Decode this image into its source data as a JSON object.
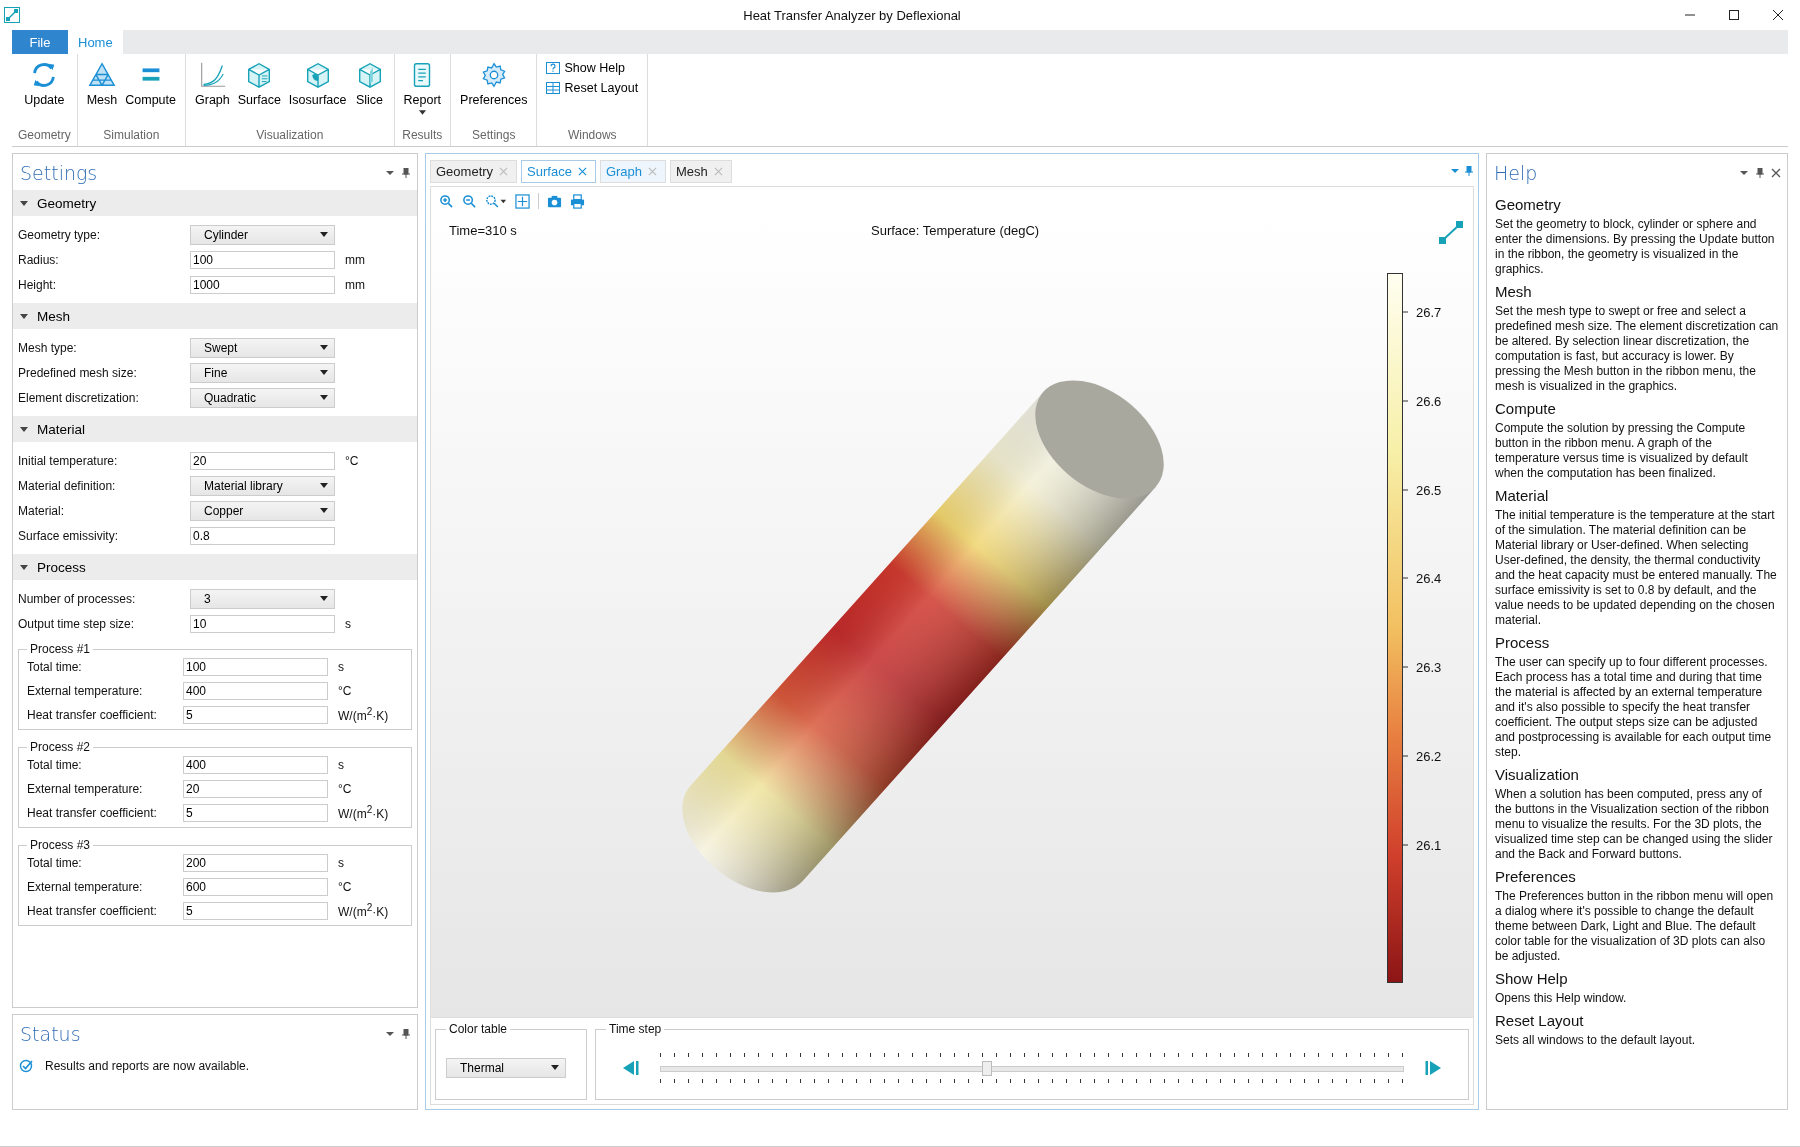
{
  "window": {
    "title": "Heat Transfer Analyzer by Deflexional"
  },
  "ribbon_tabs": [
    {
      "label": "File",
      "selected": false,
      "kind": "file"
    },
    {
      "label": "Home",
      "selected": true,
      "kind": "tab"
    }
  ],
  "ribbon_groups": [
    {
      "label": "Geometry",
      "kind": "large",
      "buttons": [
        {
          "label": "Update"
        }
      ]
    },
    {
      "label": "Simulation",
      "kind": "large",
      "buttons": [
        {
          "label": "Mesh"
        },
        {
          "label": "Compute"
        }
      ]
    },
    {
      "label": "Visualization",
      "kind": "large",
      "buttons": [
        {
          "label": "Graph"
        },
        {
          "label": "Surface"
        },
        {
          "label": "Isosurface"
        },
        {
          "label": "Slice"
        }
      ]
    },
    {
      "label": "Results",
      "kind": "large",
      "buttons": [
        {
          "label": "Report",
          "dropdown": true
        }
      ]
    },
    {
      "label": "Settings",
      "kind": "large",
      "buttons": [
        {
          "label": "Preferences"
        }
      ]
    },
    {
      "label": "Windows",
      "kind": "small",
      "buttons": [
        {
          "label": "Show Help"
        },
        {
          "label": "Reset Layout"
        }
      ]
    }
  ],
  "settings": {
    "title": "Settings",
    "sections": [
      {
        "title": "Geometry",
        "expanded": true,
        "rows": [
          {
            "label": "Geometry type:",
            "kind": "select",
            "value": "Cylinder"
          },
          {
            "label": "Radius:",
            "kind": "input",
            "value": "100",
            "unit": "mm"
          },
          {
            "label": "Height:",
            "kind": "input",
            "value": "1000",
            "unit": "mm"
          }
        ]
      },
      {
        "title": "Mesh",
        "expanded": true,
        "rows": [
          {
            "label": "Mesh type:",
            "kind": "select",
            "value": "Swept"
          },
          {
            "label": "Predefined mesh size:",
            "kind": "select",
            "value": "Fine"
          },
          {
            "label": "Element discretization:",
            "kind": "select",
            "value": "Quadratic"
          }
        ]
      },
      {
        "title": "Material",
        "expanded": true,
        "rows": [
          {
            "label": "Initial temperature:",
            "kind": "input",
            "value": "20",
            "unit": "°C"
          },
          {
            "label": "Material definition:",
            "kind": "select",
            "value": "Material library"
          },
          {
            "label": "Material:",
            "kind": "select",
            "value": "Copper"
          },
          {
            "label": "Surface emissivity:",
            "kind": "input",
            "value": "0.8"
          }
        ]
      },
      {
        "title": "Process",
        "expanded": true,
        "rows": [
          {
            "label": "Number of processes:",
            "kind": "select",
            "value": "3"
          },
          {
            "label": "Output time step size:",
            "kind": "input",
            "value": "10",
            "unit": "s"
          }
        ],
        "groups": [
          {
            "title": "Process #1",
            "rows": [
              {
                "label": "Total time:",
                "kind": "input",
                "value": "100",
                "unit": "s"
              },
              {
                "label": "External temperature:",
                "kind": "input",
                "value": "400",
                "unit": "°C"
              },
              {
                "label": "Heat transfer coefficient:",
                "kind": "input",
                "value": "5",
                "unit": "W/(m$^{2}$·K)"
              }
            ]
          },
          {
            "title": "Process #2",
            "rows": [
              {
                "label": "Total time:",
                "kind": "input",
                "value": "400",
                "unit": "s"
              },
              {
                "label": "External temperature:",
                "kind": "input",
                "value": "20",
                "unit": "°C"
              },
              {
                "label": "Heat transfer coefficient:",
                "kind": "input",
                "value": "5",
                "unit": "W/(m$^{2}$·K)"
              }
            ]
          },
          {
            "title": "Process #3",
            "rows": [
              {
                "label": "Total time:",
                "kind": "input",
                "value": "200",
                "unit": "s"
              },
              {
                "label": "External temperature:",
                "kind": "input",
                "value": "600",
                "unit": "°C"
              },
              {
                "label": "Heat transfer coefficient:",
                "kind": "input",
                "value": "5",
                "unit": "W/(m$^{2}$·K)"
              }
            ]
          }
        ]
      }
    ]
  },
  "status": {
    "title": "Status",
    "message": "Results and reports are now available."
  },
  "view_tabs": [
    {
      "label": "Geometry",
      "selected": false,
      "hovered": false
    },
    {
      "label": "Surface",
      "selected": true,
      "hovered": false
    },
    {
      "label": "Graph",
      "selected": false,
      "hovered": true
    },
    {
      "label": "Mesh",
      "selected": false,
      "hovered": false
    }
  ],
  "plot": {
    "time_label": "Time=310 s",
    "title": "Surface: Temperature (degC)",
    "colorbar_labels": [
      "26.7",
      "26.6",
      "26.5",
      "26.4",
      "26.3",
      "26.2",
      "26.1"
    ]
  },
  "color_table": {
    "label": "Color table",
    "value": "Thermal"
  },
  "time_step": {
    "label": "Time step",
    "level": 0.44
  },
  "help": {
    "title": "Help",
    "sections": [
      {
        "heading": "Geometry",
        "text": "Set the geometry to block, cylinder or sphere and enter the dimensions. By pressing the Update button in the ribbon, the geometry is visualized in the graphics."
      },
      {
        "heading": "Mesh",
        "text": "Set the mesh type to swept or free and select a predefined mesh size.  The element discretization can be altered. By selection linear discretization, the computation is fast, but accuracy is lower.  By pressing the Mesh button in the ribbon menu, the mesh is visualized in the graphics."
      },
      {
        "heading": "Compute",
        "text": "Compute the solution by pressing the Compute button in the ribbon menu. A graph of the temperature versus time is visualized by default when the computation has been finalized."
      },
      {
        "heading": "Material",
        "text": "The initial temperature is the temperature at the start of the simulation. The material definition can be Material library or User-defined. When selecting User-defined, the density, the thermal conductivity and the heat capacity must be entered manually. The surface emissivity is set to 0.8 by default, and the value needs to be updated depending on the chosen material."
      },
      {
        "heading": "Process",
        "text": "The user can specify up to four different processes. Each process has a total time and during that time the material is affected by an external temperature and it's also possible to specify the heat transfer coefficient. The output steps size can be adjusted and postprocessing is available for each output time step."
      },
      {
        "heading": "Visualization",
        "text": "When a solution has been computed, press any of the buttons in the Visualization section of the ribbon menu to visualize the results. For the 3D plots, the visualized time step can be changed using the slider and the Back and Forward buttons."
      },
      {
        "heading": "Preferences",
        "text": "The Preferences button in the ribbon menu will open a dialog where it's possible to change the default theme between Dark, Light and Blue. The default color table for the visualization of 3D plots can also be adjusted."
      },
      {
        "heading": "Show Help",
        "text": "Opens this Help window."
      },
      {
        "heading": "Reset Layout",
        "text": "Sets all windows to the default layout."
      }
    ]
  }
}
